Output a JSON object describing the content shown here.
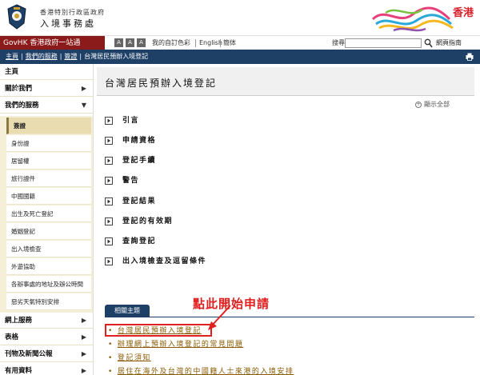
{
  "header": {
    "dept_small": "香港特別行政區政府",
    "dept_big": "入境事務處",
    "brand_text": "香港"
  },
  "toolbar": {
    "govhk": "GovHK 香港政府一站通",
    "size_buttons": [
      "A",
      "A",
      "A"
    ],
    "colour": "我的自訂色彩",
    "english": "English",
    "simplified": "簡体",
    "search_label": "搜尋",
    "search_value": "",
    "sitemap": "網頁指南"
  },
  "breadcrumb": {
    "items": [
      "主頁",
      "我們的服務",
      "簽證",
      "台灣居民預辦入境登記"
    ]
  },
  "nav": {
    "top_items": [
      "主頁",
      "關於我們",
      "我們的服務"
    ],
    "sub_items": [
      "簽證",
      "身份證",
      "居留權",
      "旅行證件",
      "中國國籍",
      "出生及死亡登記",
      "婚姻登記",
      "出入境檢查",
      "外遊協助",
      "各辦事處的地址及辦公時間",
      "惡劣天氣特別安排"
    ],
    "bottom_items": [
      "網上服務",
      "表格",
      "刊物及新聞公報",
      "有用資料"
    ],
    "expand_arrow": "▼",
    "collapse_arrow": "▶"
  },
  "main": {
    "title": "台灣居民預辦入境登記",
    "expand_all": "顯示全部",
    "sections": [
      "引言",
      "申請資格",
      "登記手續",
      "警告",
      "登記結果",
      "登記的有效期",
      "查詢登記",
      "出入境檢查及逗留條件"
    ],
    "related_tab": "相關主題",
    "related_links": [
      "台灣居民預辦入境登記",
      "辦理網上預辦入境登記的常見問題",
      "登記須知",
      "居住在海外及台灣的中國籍人士來港的入境安排"
    ],
    "annotation": "點此開始申請"
  },
  "colors": {
    "govhk_bg": "#8b1a1a",
    "navy": "#1e3f66",
    "highlight": "#e02020",
    "link": "#8a5a00"
  }
}
